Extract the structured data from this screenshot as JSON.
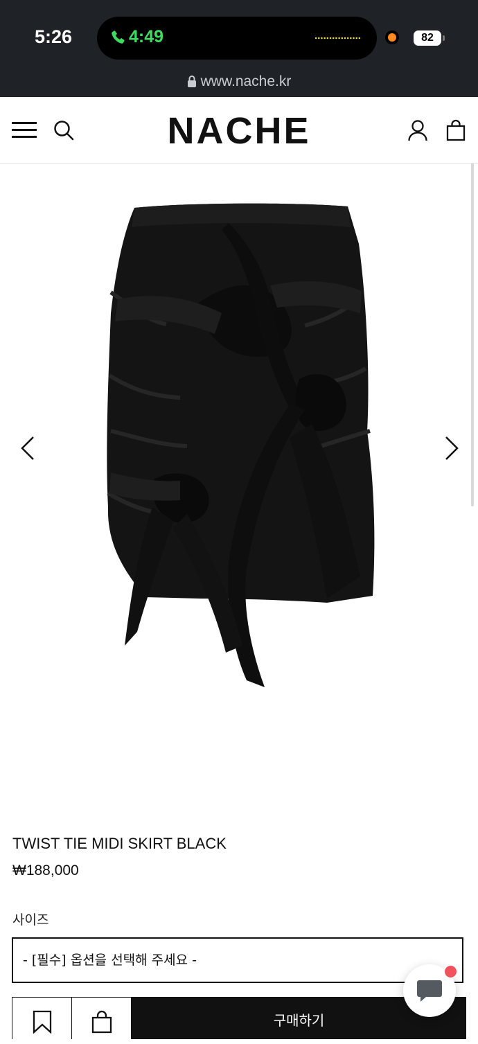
{
  "status_bar": {
    "time": "5:26",
    "call_time": "4:49",
    "battery": "82",
    "url": "www.nache.kr",
    "colors": {
      "background": "#1f2328",
      "call_green": "#3ddc5f",
      "wave_yellow": "#f3e14b",
      "dot_orange": "#ff8a1f"
    }
  },
  "header": {
    "logo": "NACHE",
    "icons": [
      "menu-icon",
      "search-icon",
      "user-icon",
      "shopping-bag-icon"
    ]
  },
  "gallery": {
    "image": "black twist tie midi skirt",
    "prev_icon": "chevron-left-icon",
    "next_icon": "chevron-right-icon"
  },
  "product": {
    "name": "TWIST TIE MIDI SKIRT BLACK",
    "price": "₩188,000"
  },
  "options": {
    "label": "사이즈",
    "select_value": "- [필수] 옵션을 선택해 주세요 -"
  },
  "actions": {
    "wishlist_icon": "bookmark-icon",
    "cart_icon": "shopping-bag-icon",
    "buy_label": "구매하기"
  },
  "chat": {
    "icon": "chat-bubble-icon",
    "badge_color": "#f2525b"
  }
}
